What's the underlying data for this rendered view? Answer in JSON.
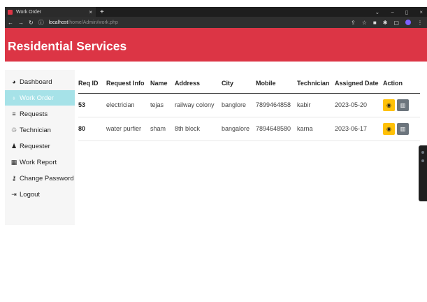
{
  "browser": {
    "tab_title": "Work Order",
    "tab_close": "×",
    "new_tab": "+",
    "url_host": "localhost",
    "url_path": "/home/Admin/work.php",
    "minimize": "−",
    "restore": "▯",
    "close": "×"
  },
  "header": {
    "title": "Residential Services"
  },
  "sidebar": {
    "items": [
      {
        "icon": "dashboard-icon",
        "label": "Dashboard",
        "active": false
      },
      {
        "icon": "work-order-icon",
        "label": "Work Order",
        "active": true
      },
      {
        "icon": "requests-icon",
        "label": "Requests",
        "active": false
      },
      {
        "icon": "technician-icon",
        "label": "Technician",
        "active": false
      },
      {
        "icon": "requester-icon",
        "label": "Requester",
        "active": false
      },
      {
        "icon": "work-report-icon",
        "label": "Work Report",
        "active": false
      },
      {
        "icon": "change-password-icon",
        "label": "Change Password",
        "active": false
      },
      {
        "icon": "logout-icon",
        "label": "Logout",
        "active": false
      }
    ]
  },
  "table": {
    "headers": [
      "Req ID",
      "Request Info",
      "Name",
      "Address",
      "City",
      "Mobile",
      "Technician",
      "Assigned Date",
      "Action"
    ],
    "rows": [
      {
        "id": "53",
        "info": "electrician",
        "name": "tejas",
        "address": "railway colony",
        "city": "banglore",
        "mobile": "7899464858",
        "technician": "kabir",
        "date": "2023-05-20"
      },
      {
        "id": "80",
        "info": "water purfier",
        "name": "sham",
        "address": "8th block",
        "city": "bangalore",
        "mobile": "7894648580",
        "technician": "karna",
        "date": "2023-06-17"
      }
    ]
  },
  "colors": {
    "header": "#dc3545",
    "active": "#a6e2e8",
    "view_button": "#ffc107",
    "delete_button": "#6c757d"
  }
}
